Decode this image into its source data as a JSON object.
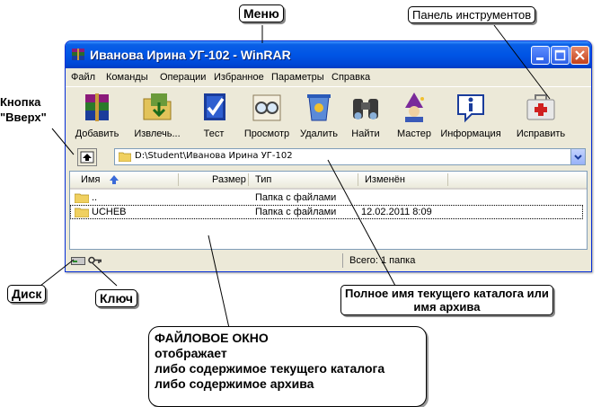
{
  "window": {
    "title": "Иванова Ирина УГ-102 - WinRAR",
    "menu": [
      "Файл",
      "Команды",
      "Операции",
      "Избранное",
      "Параметры",
      "Справка"
    ],
    "toolbar": [
      {
        "label": "Добавить",
        "icon": "books-archive-icon"
      },
      {
        "label": "Извлечь...",
        "icon": "extract-icon"
      },
      {
        "label": "Тест",
        "icon": "test-icon"
      },
      {
        "label": "Просмотр",
        "icon": "view-glasses-icon"
      },
      {
        "label": "Удалить",
        "icon": "delete-icon"
      },
      {
        "label": "Найти",
        "icon": "binoculars-icon"
      },
      {
        "label": "Мастер",
        "icon": "wizard-icon"
      },
      {
        "label": "Информация",
        "icon": "info-icon"
      },
      {
        "label": "Исправить",
        "icon": "first-aid-icon"
      }
    ],
    "address": "D:\\Student\\Иванова Ирина УГ-102",
    "columns": {
      "name": "Имя",
      "size": "Размер",
      "type": "Тип",
      "modified": "Изменён"
    },
    "rows": [
      {
        "name": "..",
        "size": "",
        "type": "Папка с файлами",
        "modified": ""
      },
      {
        "name": "UCHEB",
        "size": "",
        "type": "Папка с файлами",
        "modified": "12.02.2011 8:09"
      }
    ],
    "status": "Всего: 1 папка"
  },
  "callouts": {
    "menu": "Меню",
    "toolbar": "Панель инструментов",
    "up_button": [
      "Кнопка",
      "\"Вверх\""
    ],
    "disk": "Диск",
    "key": "Ключ",
    "path": [
      "Полное имя текущего каталога или",
      "имя архива"
    ],
    "file_window": [
      "ФАЙЛОВОЕ ОКНО",
      "отображает",
      "либо содержимое  текущего каталога",
      "либо содержимое архива"
    ]
  }
}
